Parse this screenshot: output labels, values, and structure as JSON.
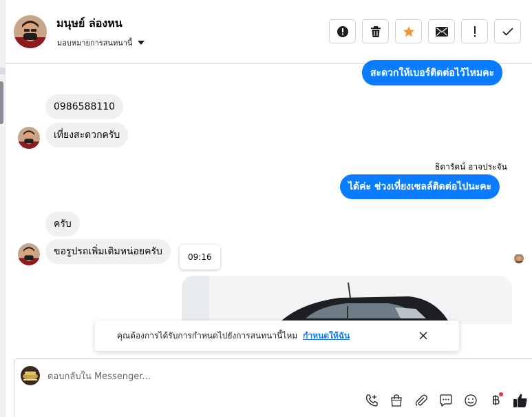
{
  "contact": {
    "name": "มนุษย์ ล่องหน",
    "assign_label": "มอบหมายการสนทนานี้"
  },
  "toolbar": {
    "buttons": [
      {
        "name": "mark-spam",
        "icon": "alert-circle-icon"
      },
      {
        "name": "delete",
        "icon": "trash-icon"
      },
      {
        "name": "star",
        "icon": "star-icon",
        "color": "#f7923b"
      },
      {
        "name": "mark-unread",
        "icon": "envelope-icon"
      },
      {
        "name": "follow-up",
        "icon": "exclamation-icon"
      },
      {
        "name": "done",
        "icon": "check-icon"
      }
    ]
  },
  "messages": {
    "out_1": "สะดวกให้เบอร์ติดต่อไว้ไหมคะ",
    "in_phone": "0986588110",
    "in_noon": "เที่ยงสะดวกครับ",
    "sender_name": "ธิดารัตน์ อาจประจัน",
    "out_2": "ได้ค่ะ ช่วงเที่ยงเซลล์ติดต่อไปนะคะ",
    "in_yes": "ครับ",
    "in_more_pics": "ขอรูปรถเพิ่มเติมหน่อยครับ",
    "tooltip_time": "09:16"
  },
  "notice": {
    "text": "คุณต้องการได้รับการกำหนดไปยังการสนทนานี้ไหม",
    "link": "กำหนดให้ฉัน"
  },
  "composer": {
    "placeholder": "ตอบกลับใน Messenger...",
    "icons": [
      "call-icon",
      "shopping-bag-icon",
      "attachment-icon",
      "saved-reply-icon",
      "emoji-icon",
      "baht-payment-icon",
      "thumbs-up-icon"
    ]
  },
  "colors": {
    "outgoing_bubble": "#0a7cff",
    "incoming_bubble": "#f0f0f0",
    "link": "#1877f2",
    "star": "#f7923b"
  }
}
